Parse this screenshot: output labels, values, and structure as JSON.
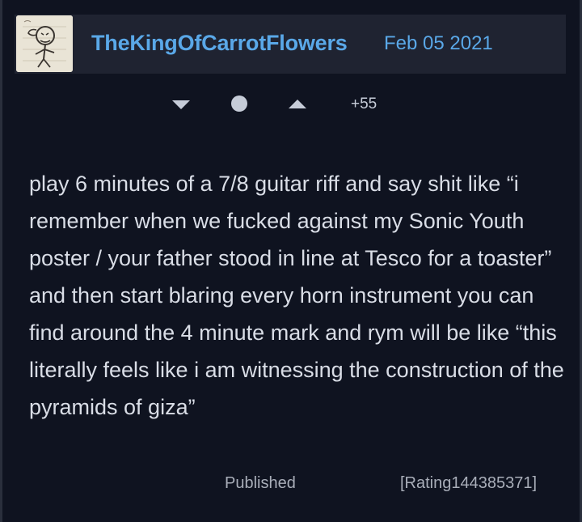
{
  "theme": {
    "background": "#0f1320",
    "header_background": "#1f2331",
    "link_color": "#5aa8e8",
    "text_color": "#d9dde6",
    "muted_color": "#a9aeb9",
    "vote_color": "#c6ccd8"
  },
  "review": {
    "username": "TheKingOfCarrotFlowers",
    "date": "Feb 05 2021",
    "avatar_icon": "sketch-avatar-icon",
    "votes": {
      "score": "+55"
    },
    "body": "play 6 minutes of a 7/8 guitar riff and say shit like “i remember when we fucked against my Sonic Youth poster / your father stood in line at Tesco for a toaster” and then start blaring every horn instrument you can find around the 4 minute mark and rym will be like “this literally feels like i am witnessing the construction of the pyramids of giza”",
    "status": "Published",
    "rating_ref": "[Rating144385371]"
  }
}
